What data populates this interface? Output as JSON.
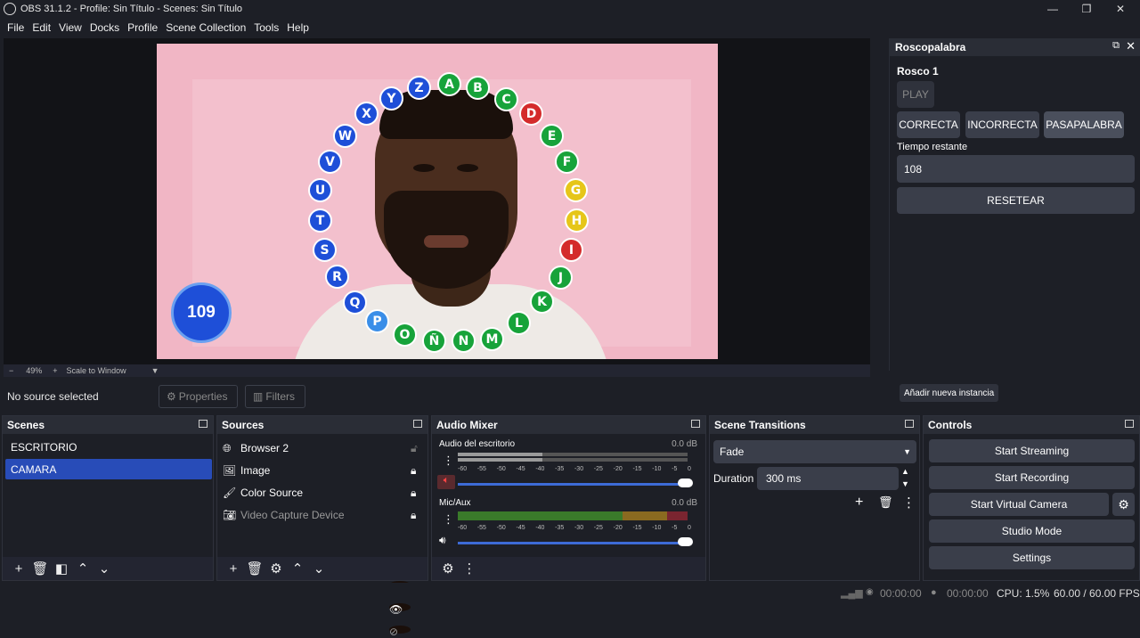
{
  "window": {
    "title": "OBS 31.1.2 - Profile: Sin Título - Scenes: Sin Título"
  },
  "menu": [
    "File",
    "Edit",
    "View",
    "Docks",
    "Profile",
    "Scene Collection",
    "Tools",
    "Help"
  ],
  "preview": {
    "letters": [
      {
        "l": "A",
        "c": "green"
      },
      {
        "l": "B",
        "c": "green"
      },
      {
        "l": "C",
        "c": "green"
      },
      {
        "l": "D",
        "c": "red"
      },
      {
        "l": "E",
        "c": "green"
      },
      {
        "l": "F",
        "c": "green"
      },
      {
        "l": "G",
        "c": "yellow"
      },
      {
        "l": "H",
        "c": "yellow"
      },
      {
        "l": "I",
        "c": "red"
      },
      {
        "l": "J",
        "c": "green"
      },
      {
        "l": "K",
        "c": "green"
      },
      {
        "l": "L",
        "c": "green"
      },
      {
        "l": "M",
        "c": "green"
      },
      {
        "l": "N",
        "c": "green"
      },
      {
        "l": "Ñ",
        "c": "green"
      },
      {
        "l": "O",
        "c": "green"
      },
      {
        "l": "P",
        "c": "lightblue"
      },
      {
        "l": "Q",
        "c": "blue"
      },
      {
        "l": "R",
        "c": "blue"
      },
      {
        "l": "S",
        "c": "blue"
      },
      {
        "l": "T",
        "c": "blue"
      },
      {
        "l": "U",
        "c": "blue"
      },
      {
        "l": "V",
        "c": "blue"
      },
      {
        "l": "W",
        "c": "blue"
      },
      {
        "l": "X",
        "c": "blue"
      },
      {
        "l": "Y",
        "c": "blue"
      },
      {
        "l": "Z",
        "c": "blue"
      }
    ],
    "timer": "109"
  },
  "zoom": {
    "minus": "−",
    "percent": "49%",
    "plus": "+",
    "mode": "Scale to Window"
  },
  "source_bar": {
    "no_source": "No source selected",
    "properties": "Properties",
    "filters": "Filters"
  },
  "rosco": {
    "title": "Roscopalabra",
    "instance": "Rosco 1",
    "play": "PLAY",
    "correcta": "CORRECTA",
    "incorrecta": "INCORRECTA",
    "pasapalabra": "PASAPALABRA",
    "tiempo_label": "Tiempo restante",
    "tiempo_value": "108",
    "resetear": "RESETEAR",
    "add_instance": "Añadir nueva instancia"
  },
  "scenes": {
    "title": "Scenes",
    "items": [
      "ESCRITORIO",
      "CAMARA"
    ],
    "active": "CAMARA"
  },
  "sources": {
    "title": "Sources",
    "items": [
      {
        "name": "Browser 2",
        "icon": "globe-icon",
        "visible": true,
        "locked": false
      },
      {
        "name": "Image",
        "icon": "image-icon",
        "visible": true,
        "locked": true
      },
      {
        "name": "Color Source",
        "icon": "brush-icon",
        "visible": true,
        "locked": true
      },
      {
        "name": "Video Capture Device",
        "icon": "camera-icon",
        "visible": false,
        "locked": true
      }
    ]
  },
  "mixer": {
    "title": "Audio Mixer",
    "tracks": [
      {
        "name": "Audio del escritorio",
        "db": "0.0 dB",
        "muted": true
      },
      {
        "name": "Mic/Aux",
        "db": "0.0 dB",
        "muted": false
      }
    ],
    "ticks": [
      "-60",
      "-55",
      "-50",
      "-45",
      "-40",
      "-35",
      "-30",
      "-25",
      "-20",
      "-15",
      "-10",
      "-5",
      "0"
    ]
  },
  "transitions": {
    "title": "Scene Transitions",
    "selected": "Fade",
    "duration_label": "Duration",
    "duration_value": "300 ms"
  },
  "controls": {
    "title": "Controls",
    "start_streaming": "Start Streaming",
    "start_recording": "Start Recording",
    "start_virtual_camera": "Start Virtual Camera",
    "studio_mode": "Studio Mode",
    "settings": "Settings"
  },
  "status": {
    "stream_time": "00:00:00",
    "rec_time": "00:00:00",
    "cpu": "CPU: 1.5%",
    "fps": "60.00 / 60.00 FPS"
  }
}
